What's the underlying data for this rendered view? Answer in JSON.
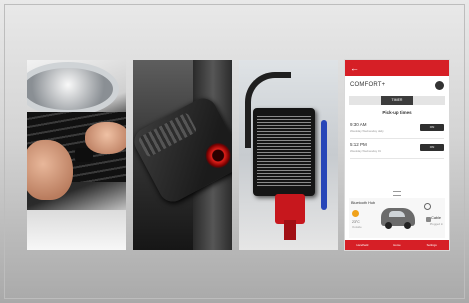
{
  "app": {
    "title": "COMFORT+",
    "tabs": [
      {
        "label": ""
      },
      {
        "label": "TIMER"
      },
      {
        "label": ""
      }
    ],
    "pickup_section_title": "Pick-up times",
    "pickup_times": [
      {
        "time": "9:30 AM",
        "detail": "Weekday\nWednesday  daily",
        "toggle": "ON"
      },
      {
        "time": "5:12 PM",
        "detail": "Weekday\nWednesday  01",
        "toggle": "ON"
      }
    ],
    "hub": {
      "title": "Bluetooth Hub",
      "temperature": "23°C",
      "weather_sub": "Outside",
      "clock_label": "",
      "cable_label": "Cable",
      "cable_sub": "Plugged in"
    },
    "bottom_nav": [
      "Handheld",
      "Home",
      "Settings"
    ],
    "colors": {
      "accent": "#d61f26"
    }
  },
  "icons": [
    "back-icon",
    "power-icon",
    "handle-icon",
    "weather-icon",
    "car-icon",
    "clock-icon",
    "plug-icon"
  ]
}
